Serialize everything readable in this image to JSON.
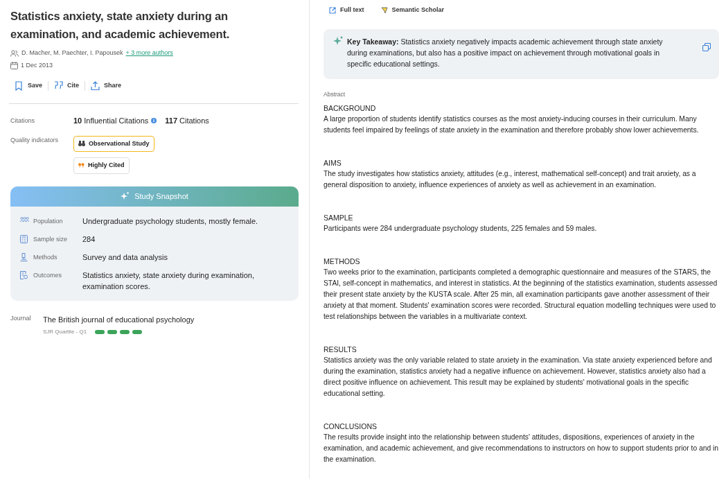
{
  "title": "Statistics anxiety, state anxiety during an examination, and academic achievement.",
  "authors": {
    "names": "D. Macher, M. Paechter, I. Papousek",
    "more": "+ 3 more authors"
  },
  "date": "1 Dec 2013",
  "actions": [
    "Save",
    "Cite",
    "Share"
  ],
  "citations": {
    "label": "Citations",
    "influential_count": "10",
    "influential_label": "Influential Citations",
    "count": "117",
    "count_label": "Citations"
  },
  "quality": {
    "label": "Quality indicators",
    "badges": [
      {
        "kind": "observational",
        "text": "Observational Study"
      },
      {
        "kind": "cited",
        "text": "Highly Cited"
      }
    ]
  },
  "snapshot": {
    "title": "Study Snapshot",
    "rows": [
      {
        "kind": "population",
        "label": "Population",
        "value": "Undergraduate psychology students, mostly female."
      },
      {
        "kind": "sample",
        "label": "Sample size",
        "value": "284"
      },
      {
        "kind": "methods",
        "label": "Methods",
        "value": "Survey and data analysis"
      },
      {
        "kind": "outcomes",
        "label": "Outcomes",
        "value": "Statistics anxiety, state anxiety during examination, examination scores."
      }
    ]
  },
  "journal": {
    "label": "Journal",
    "name": "The British journal of educational psychology",
    "quartile": "SJR Quartile - Q1",
    "stars": 4
  },
  "links": [
    {
      "kind": "fulltext",
      "text": "Full text"
    },
    {
      "kind": "scholar",
      "text": "Semantic Scholar"
    }
  ],
  "takeaway": "**Key Takeaway:** Statistics anxiety negatively impacts academic achievement through state anxiety during examinations, but also has a positive impact on achievement through motivational goals in specific educational settings.",
  "abstract": {
    "label": "Abstract",
    "sections": [
      {
        "heading": "BACKGROUND",
        "text": "A large proportion of students identify statistics courses as the most anxiety-inducing courses in their curriculum. Many students feel impaired by feelings of state anxiety in the examination and therefore probably show lower achievements."
      },
      {
        "heading": "AIMS",
        "text": "The study investigates how statistics anxiety, attitudes (e.g., interest, mathematical self-concept) and trait anxiety, as a general disposition to anxiety, influence experiences of anxiety as well as achievement in an examination."
      },
      {
        "heading": "SAMPLE",
        "text": "Participants were 284 undergraduate psychology students, 225 females and 59 males."
      },
      {
        "heading": "METHODS",
        "text": "Two weeks prior to the examination, participants completed a demographic questionnaire and measures of the STARS, the STAI, self-concept in mathematics, and interest in statistics. At the beginning of the statistics examination, students assessed their present state anxiety by the KUSTA scale. After 25 min, all examination participants gave another assessment of their anxiety at that moment. Students' examination scores were recorded. Structural equation modelling techniques were used to test relationships between the variables in a multivariate context."
      },
      {
        "heading": "RESULTS",
        "text": "Statistics anxiety was the only variable related to state anxiety in the examination. Via state anxiety experienced before and during the examination, statistics anxiety had a negative influence on achievement. However, statistics anxiety also had a direct positive influence on achievement. This result may be explained by students' motivational goals in the specific educational setting."
      },
      {
        "heading": "CONCLUSIONS",
        "text": "The results provide insight into the relationship between students' attitudes, dispositions, experiences of anxiety in the examination, and academic achievement, and give recommendations to instructors on how to support students prior to and in the examination."
      }
    ]
  }
}
